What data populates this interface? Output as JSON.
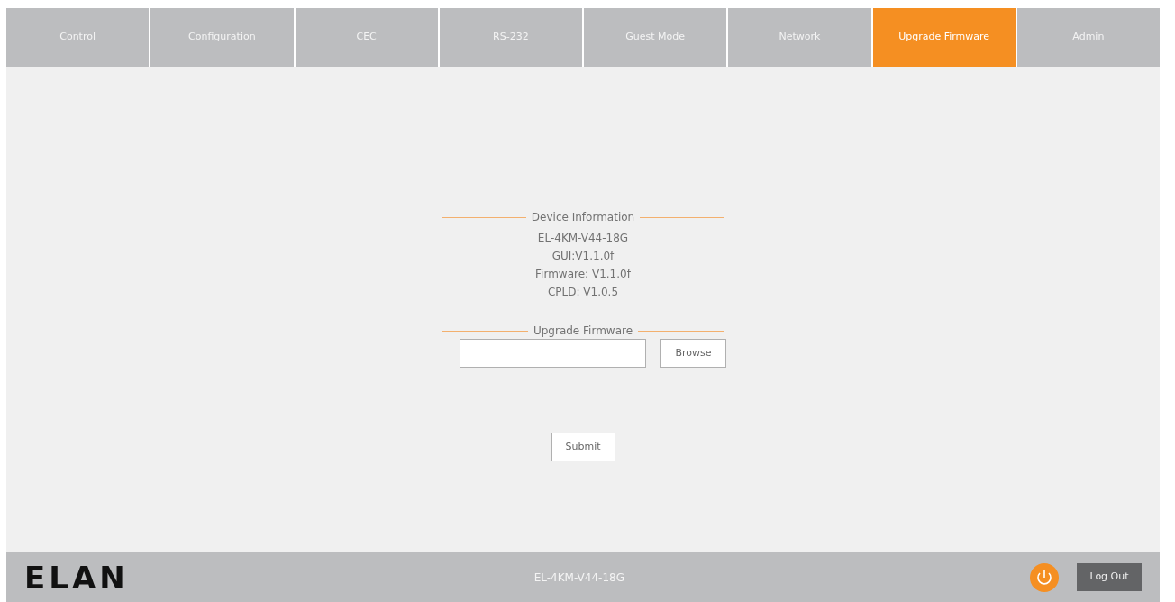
{
  "tabs": [
    {
      "label": "Control",
      "selected": false
    },
    {
      "label": "Configuration",
      "selected": false
    },
    {
      "label": "CEC",
      "selected": false
    },
    {
      "label": "RS-232",
      "selected": false
    },
    {
      "label": "Guest Mode",
      "selected": false
    },
    {
      "label": "Network",
      "selected": false
    },
    {
      "label": "Upgrade Firmware",
      "selected": true
    },
    {
      "label": "Admin",
      "selected": false
    }
  ],
  "device_information": {
    "heading": "Device Information",
    "lines": [
      "EL-4KM-V44-18G",
      "GUI:V1.1.0f",
      "Firmware: V1.1.0f",
      "CPLD: V1.0.5"
    ]
  },
  "upgrade_firmware": {
    "heading": "Upgrade Firmware",
    "browse_button": "Browse",
    "submit_button": "Submit"
  },
  "footer": {
    "logo": "ELAN",
    "model": "EL-4KM-V44-18G",
    "logout_button": "Log Out"
  }
}
